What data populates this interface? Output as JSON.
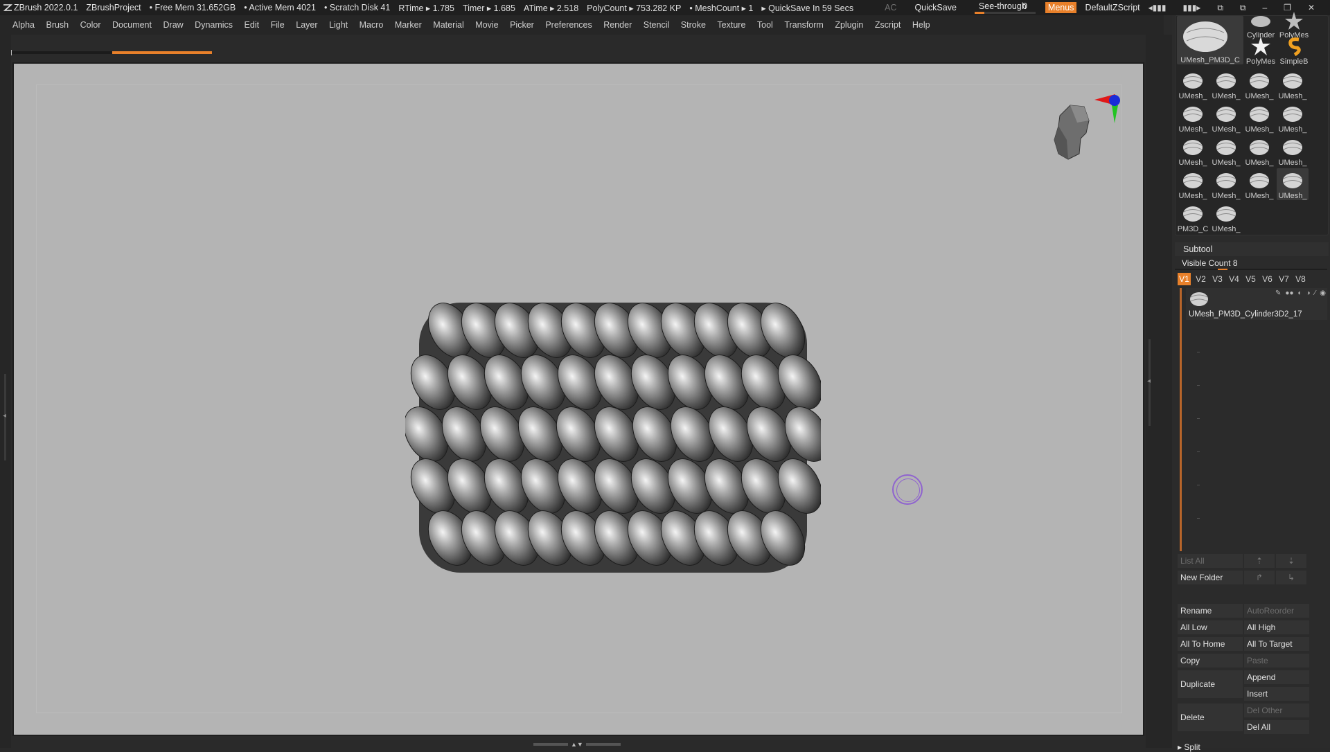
{
  "titlebar": {
    "app": "ZBrush 2022.0.1",
    "project": "ZBrushProject",
    "free_mem": "• Free Mem 31.652GB",
    "active_mem": "• Active Mem 4021",
    "scratch": "• Scratch Disk 41",
    "rtime": "RTime ▸ 1.785",
    "timer": "Timer ▸ 1.685",
    "atime": "ATime ▸ 2.518",
    "polycount": "PolyCount ▸ 753.282 KP",
    "meshcount": "• MeshCount ▸ 1",
    "quicksave_in": "▸ QuickSave In 59 Secs",
    "ac": "AC",
    "quicksave": "QuickSave",
    "see_through_label": "See-through",
    "see_through_value": "0",
    "see_through_fraction": 0,
    "menus": "Menus",
    "default_zscript": "DefaultZScript"
  },
  "menubar": [
    "Alpha",
    "Brush",
    "Color",
    "Document",
    "Draw",
    "Dynamics",
    "Edit",
    "File",
    "Layer",
    "Light",
    "Macro",
    "Marker",
    "Material",
    "Movie",
    "Picker",
    "Preferences",
    "Render",
    "Stencil",
    "Stroke",
    "Texture",
    "Tool",
    "Transform",
    "Zplugin",
    "Zscript",
    "Help"
  ],
  "progress_fraction": 0.5,
  "colors": {
    "accent": "#e8802a",
    "canvas": "#b4b4b4",
    "brush_cursor": "#8f63cf",
    "gizmo_x": "#e01818",
    "gizmo_y": "#22c422",
    "gizmo_z": "#1a2cd8"
  },
  "tool_thumbs": {
    "big": "UMesh_PM3D_C",
    "top_right": [
      "Cylinder",
      "PolyMes"
    ],
    "second_right": [
      "PolyMes",
      "SimpleB"
    ],
    "grid": [
      "UMesh_",
      "UMesh_",
      "UMesh_",
      "UMesh_",
      "UMesh_",
      "UMesh_",
      "UMesh_",
      "UMesh_",
      "UMesh_",
      "UMesh_",
      "UMesh_",
      "UMesh_",
      "UMesh_",
      "UMesh_",
      "UMesh_",
      "UMesh_"
    ],
    "last_row": [
      "PM3D_C",
      "UMesh_"
    ]
  },
  "subtool": {
    "title": "Subtool",
    "visible_count_label": "Visible Count",
    "visible_count": "8",
    "visible_count_fraction": 0.3,
    "tabs": [
      "V1",
      "V2",
      "V3",
      "V4",
      "V5",
      "V6",
      "V7",
      "V8"
    ],
    "active_tab": "V1",
    "item_name": "UMesh_PM3D_Cylinder3D2_17",
    "buttons": {
      "list_all": "List All",
      "new_folder": "New Folder",
      "rename": "Rename",
      "autoreorder": "AutoReorder",
      "all_low": "All Low",
      "all_high": "All High",
      "all_to_home": "All To Home",
      "all_to_target": "All To Target",
      "copy": "Copy",
      "paste": "Paste",
      "duplicate": "Duplicate",
      "append": "Append",
      "insert": "Insert",
      "delete": "Delete",
      "del_other": "Del Other",
      "del_all": "Del All",
      "split": "Split"
    }
  }
}
